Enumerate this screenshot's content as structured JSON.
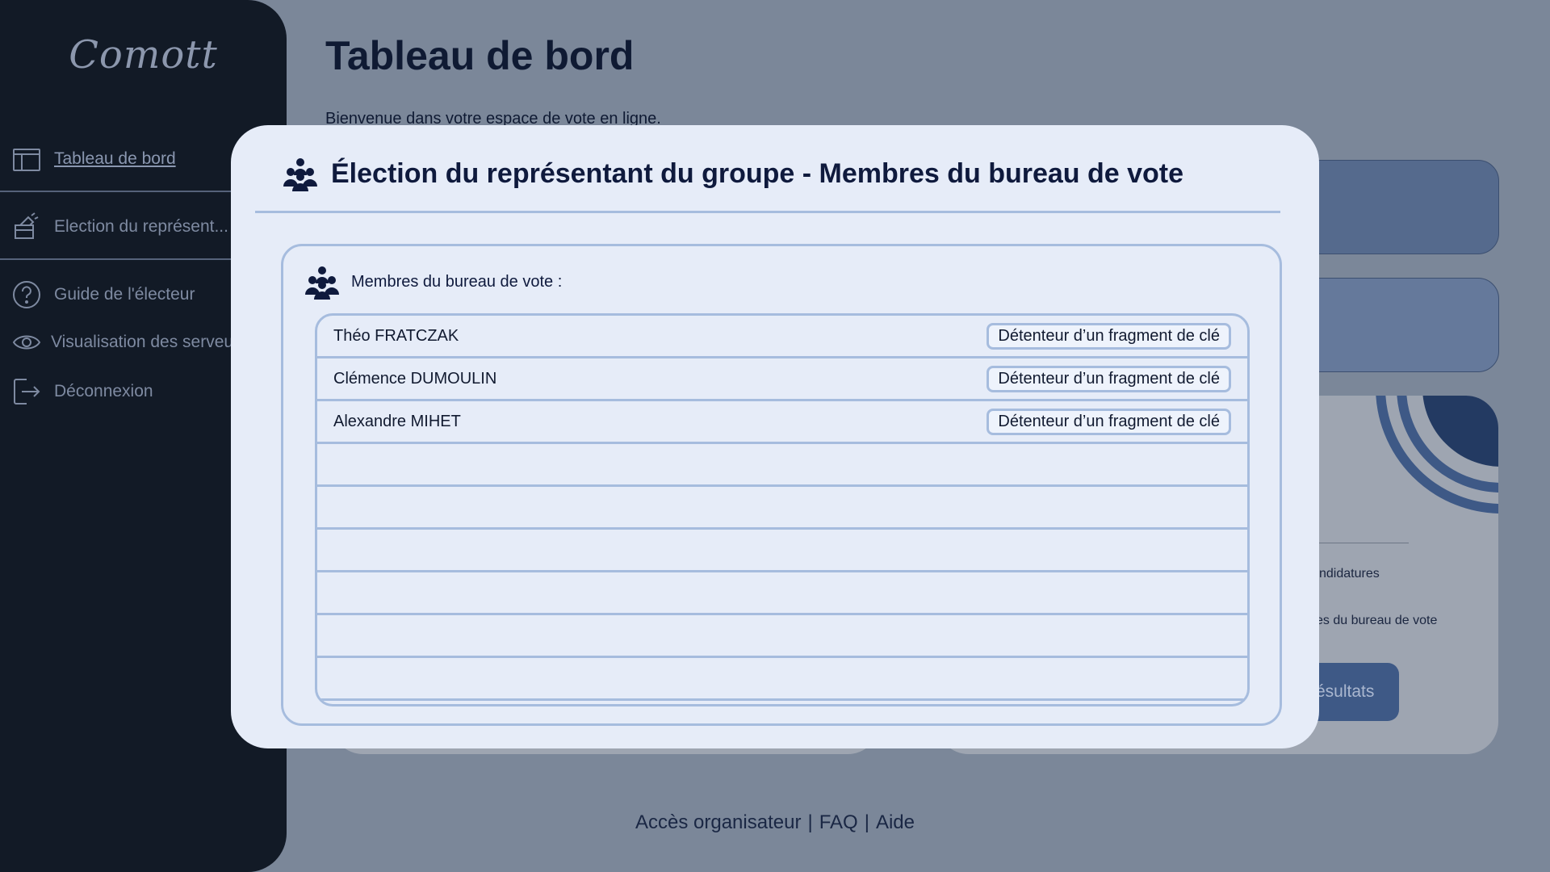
{
  "app": {
    "logo": "Comott"
  },
  "sidebar": {
    "items": [
      {
        "label": "Tableau de bord",
        "icon": "dashboard-icon",
        "active": true
      },
      {
        "label": "Election du représent...",
        "icon": "ballot-icon"
      },
      {
        "label": "Guide de l'électeur",
        "icon": "help-circle-icon"
      },
      {
        "label": "Visualisation des serveurs",
        "icon": "eye-icon"
      },
      {
        "label": "Déconnexion",
        "icon": "logout-icon"
      }
    ]
  },
  "main": {
    "title": "Tableau de bord",
    "welcome": "Bienvenue dans votre espace de vote en ligne.",
    "bg_partial": {
      "text1": "ndidatures",
      "text2": "es du bureau de vote",
      "button": "ésultats"
    }
  },
  "modal": {
    "title": "Élection du représentant du groupe - Membres du bureau de vote",
    "section_label": "Membres du bureau de vote :",
    "members": [
      {
        "name": "Théo FRATCZAK",
        "role": "Détenteur d’un fragment de clé"
      },
      {
        "name": "Clémence DUMOULIN",
        "role": "Détenteur d’un fragment de clé"
      },
      {
        "name": "Alexandre MIHET",
        "role": "Détenteur d’un fragment de clé"
      }
    ],
    "empty_rows": 6
  },
  "footer": {
    "links": [
      "Accès organisateur",
      "FAQ",
      "Aide"
    ]
  },
  "colors": {
    "sidebar": "#121a26",
    "backdrop": "#7b8799",
    "modal_bg": "#e6ecf8",
    "border": "#a6bcde",
    "accent": "#3e5986"
  }
}
